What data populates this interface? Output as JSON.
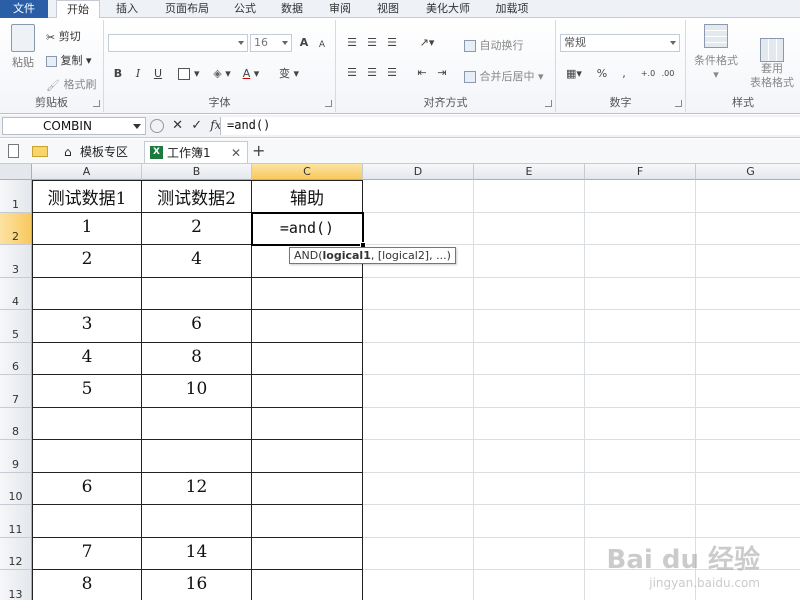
{
  "ribbon": {
    "tabs": [
      "文件",
      "开始",
      "插入",
      "页面布局",
      "公式",
      "数据",
      "审阅",
      "视图",
      "美化大师",
      "加载项"
    ],
    "active_tab": "开始",
    "clipboard": {
      "paste": "粘贴",
      "cut": "剪切",
      "copy": "复制",
      "format_painter": "格式刷",
      "label": "剪贴板"
    },
    "font": {
      "size": "16",
      "bold": "B",
      "italic": "I",
      "underline": "U",
      "grow": "A",
      "shrink": "A",
      "label": "字体",
      "phonetic": "变"
    },
    "alignment": {
      "wrap": "自动换行",
      "merge": "合并后居中",
      "label": "对齐方式"
    },
    "number": {
      "format": "常规",
      "percent": "%",
      "comma": ",",
      "label": "数字",
      "inc": "+.0",
      "dec": ".00"
    },
    "styles": {
      "conditional": "条件格式",
      "table": "套用\n表格格式",
      "label": "样式"
    }
  },
  "formula_bar": {
    "name_box": "COMBIN",
    "cancel": "✕",
    "enter": "✓",
    "fx": "fx",
    "formula": "=and()"
  },
  "doc_tabs": [
    {
      "label": "模板专区"
    },
    {
      "label": "工作簿1"
    }
  ],
  "add_tab": "+",
  "grid": {
    "columns": [
      "A",
      "B",
      "C",
      "D",
      "E",
      "F",
      "G"
    ],
    "rows": [
      "1",
      "2",
      "3",
      "4",
      "5",
      "6",
      "7",
      "8",
      "9",
      "10",
      "11",
      "12",
      "13"
    ],
    "cells": [
      [
        "测试数据1",
        "测试数据2",
        "辅助"
      ],
      [
        "1",
        "2",
        "=and()"
      ],
      [
        "2",
        "4",
        ""
      ],
      [
        "",
        "",
        ""
      ],
      [
        "3",
        "6",
        ""
      ],
      [
        "4",
        "8",
        ""
      ],
      [
        "5",
        "10",
        ""
      ],
      [
        "",
        "",
        ""
      ],
      [
        "",
        "",
        ""
      ],
      [
        "6",
        "12",
        ""
      ],
      [
        "",
        "",
        ""
      ],
      [
        "7",
        "14",
        ""
      ],
      [
        "8",
        "16",
        ""
      ]
    ],
    "active_cell": "C2",
    "tooltip": {
      "prefix": "AND(",
      "bold": "logical1",
      "suffix": ", [logical2], ...)"
    }
  },
  "watermark": {
    "line1": "Bai du 经验",
    "line2": "jingyan.baidu.com"
  }
}
